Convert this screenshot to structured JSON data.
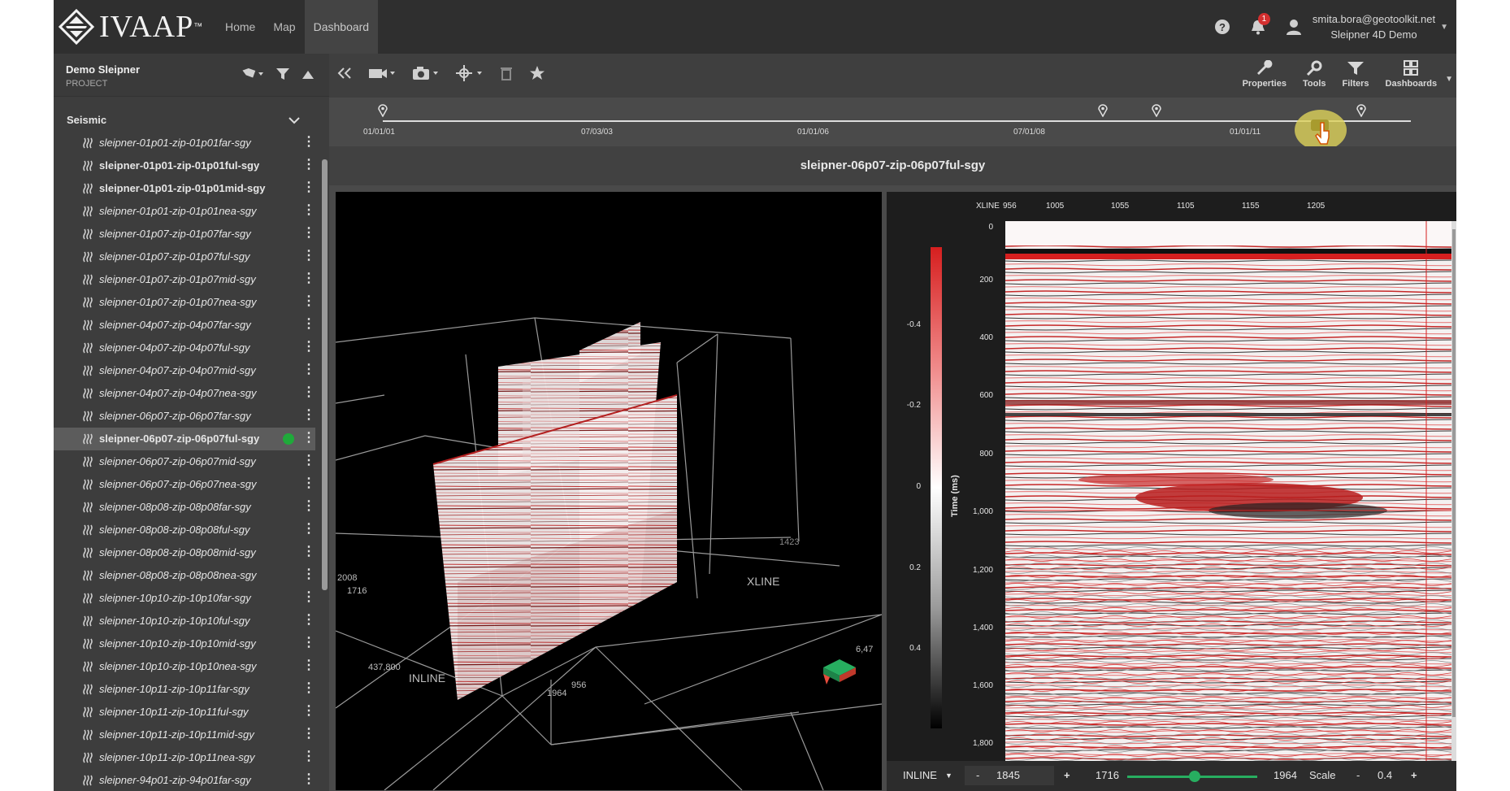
{
  "app": {
    "logo_text": "IVAAP",
    "logo_tm": "™"
  },
  "nav": {
    "items": [
      "Home",
      "Map",
      "Dashboard"
    ],
    "active": "Dashboard"
  },
  "header": {
    "notifications_count": "1",
    "user_email": "smita.bora@geotoolkit.net",
    "user_project": "Sleipner 4D Demo"
  },
  "project": {
    "name": "Demo Sleipner",
    "label": "PROJECT"
  },
  "seismic": {
    "title": "Seismic",
    "items": [
      {
        "label": "sleipner-01p01-zip-01p01far-sgy",
        "bold": false
      },
      {
        "label": "sleipner-01p01-zip-01p01ful-sgy",
        "bold": true
      },
      {
        "label": "sleipner-01p01-zip-01p01mid-sgy",
        "bold": true
      },
      {
        "label": "sleipner-01p01-zip-01p01nea-sgy",
        "bold": false
      },
      {
        "label": "sleipner-01p07-zip-01p07far-sgy",
        "bold": false
      },
      {
        "label": "sleipner-01p07-zip-01p07ful-sgy",
        "bold": false
      },
      {
        "label": "sleipner-01p07-zip-01p07mid-sgy",
        "bold": false
      },
      {
        "label": "sleipner-01p07-zip-01p07nea-sgy",
        "bold": false
      },
      {
        "label": "sleipner-04p07-zip-04p07far-sgy",
        "bold": false
      },
      {
        "label": "sleipner-04p07-zip-04p07ful-sgy",
        "bold": false
      },
      {
        "label": "sleipner-04p07-zip-04p07mid-sgy",
        "bold": false
      },
      {
        "label": "sleipner-04p07-zip-04p07nea-sgy",
        "bold": false
      },
      {
        "label": "sleipner-06p07-zip-06p07far-sgy",
        "bold": false
      },
      {
        "label": "sleipner-06p07-zip-06p07ful-sgy",
        "bold": true,
        "selected": true
      },
      {
        "label": "sleipner-06p07-zip-06p07mid-sgy",
        "bold": false
      },
      {
        "label": "sleipner-06p07-zip-06p07nea-sgy",
        "bold": false
      },
      {
        "label": "sleipner-08p08-zip-08p08far-sgy",
        "bold": false
      },
      {
        "label": "sleipner-08p08-zip-08p08ful-sgy",
        "bold": false
      },
      {
        "label": "sleipner-08p08-zip-08p08mid-sgy",
        "bold": false
      },
      {
        "label": "sleipner-08p08-zip-08p08nea-sgy",
        "bold": false
      },
      {
        "label": "sleipner-10p10-zip-10p10far-sgy",
        "bold": false
      },
      {
        "label": "sleipner-10p10-zip-10p10ful-sgy",
        "bold": false
      },
      {
        "label": "sleipner-10p10-zip-10p10mid-sgy",
        "bold": false
      },
      {
        "label": "sleipner-10p10-zip-10p10nea-sgy",
        "bold": false
      },
      {
        "label": "sleipner-10p11-zip-10p11far-sgy",
        "bold": false
      },
      {
        "label": "sleipner-10p11-zip-10p11ful-sgy",
        "bold": false
      },
      {
        "label": "sleipner-10p11-zip-10p11mid-sgy",
        "bold": false
      },
      {
        "label": "sleipner-10p11-zip-10p11nea-sgy",
        "bold": false
      },
      {
        "label": "sleipner-94p01-zip-94p01far-sgy",
        "bold": false
      }
    ]
  },
  "toolbar": {
    "right_buttons": [
      "Properties",
      "Tools",
      "Filters",
      "Dashboards"
    ]
  },
  "timeline": {
    "labels": [
      "01/01/01",
      "07/03/03",
      "01/01/06",
      "07/01/08",
      "01/01/11"
    ]
  },
  "viewer": {
    "title": "sleipner-06p07-zip-06p07ful-sgy"
  },
  "view3d": {
    "labels": {
      "inline": "INLINE",
      "xline": "XLINE",
      "v1716": "1716",
      "v2008": "2008",
      "v437800": "437,800",
      "v1964": "1964",
      "v956": "956",
      "v1423": "1423",
      "v647": "6,47"
    }
  },
  "section": {
    "x_axis_title": "XLINE",
    "x_ticks": [
      "956",
      "1005",
      "1055",
      "1105",
      "1155",
      "1205"
    ],
    "y_ticks": [
      "0",
      "200",
      "400",
      "600",
      "800",
      "1,000",
      "1,200",
      "1,400",
      "1,600",
      "1,800"
    ],
    "y_axis_title": "Time (ms)",
    "colorbar_ticks": [
      "-0.4",
      "-0.2",
      "0",
      "0.2",
      "0.4"
    ]
  },
  "controls": {
    "mode": "INLINE",
    "minus": "-",
    "plus": "+",
    "value": "1845",
    "range_min": "1716",
    "range_max": "1964",
    "slider_fraction": 0.52,
    "scale_label": "Scale",
    "scale_value": "0.4"
  },
  "colors": {
    "accent_green": "#27ae60",
    "seismic_red": "#d61f1f",
    "timeline_handle": "#ddd25a"
  }
}
